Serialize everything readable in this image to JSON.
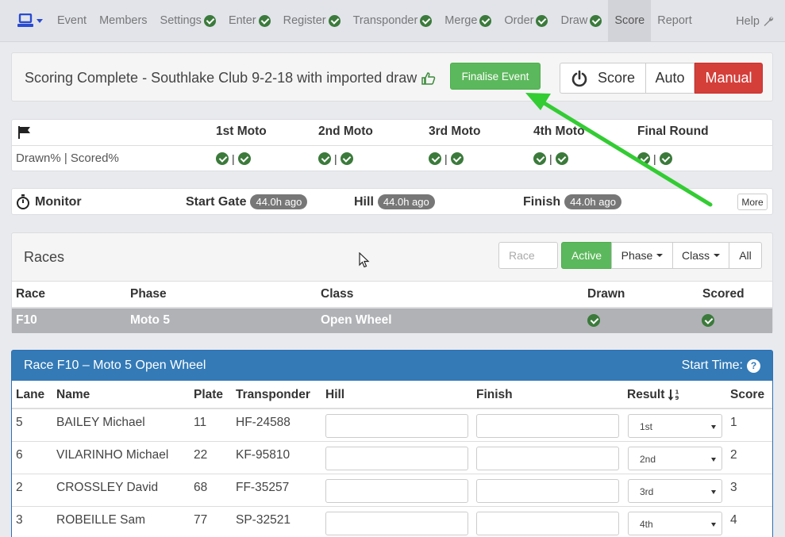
{
  "nav": {
    "items": [
      {
        "label": "Event",
        "check": false
      },
      {
        "label": "Members",
        "check": false
      },
      {
        "label": "Settings",
        "check": true
      },
      {
        "label": "Enter",
        "check": true
      },
      {
        "label": "Register",
        "check": true
      },
      {
        "label": "Transponder",
        "check": true
      },
      {
        "label": "Merge",
        "check": true
      },
      {
        "label": "Order",
        "check": true
      },
      {
        "label": "Draw",
        "check": true
      },
      {
        "label": "Score",
        "check": false
      },
      {
        "label": "Report",
        "check": false
      }
    ],
    "active": "Score",
    "help_label": "Help"
  },
  "status": {
    "title": "Scoring Complete - Southlake Club 9-2-18 with imported draw",
    "finalise_label": "Finalise Event",
    "score_label": "Score",
    "auto_label": "Auto",
    "manual_label": "Manual"
  },
  "motos": {
    "columns": [
      "1st Moto",
      "2nd Moto",
      "3rd Moto",
      "4th Moto",
      "Final Round"
    ],
    "row_label": "Drawn% | Scored%",
    "separator": "|"
  },
  "monitor": {
    "title": "Monitor",
    "start_gate_label": "Start Gate",
    "start_gate_time": "44.0h ago",
    "hill_label": "Hill",
    "hill_time": "44.0h ago",
    "finish_label": "Finish",
    "finish_time": "44.0h ago",
    "more_label": "More"
  },
  "races": {
    "title": "Races",
    "race_placeholder": "Race",
    "active_label": "Active",
    "phase_label": "Phase",
    "class_label": "Class",
    "all_label": "All",
    "headers": {
      "race": "Race",
      "phase": "Phase",
      "class": "Class",
      "drawn": "Drawn",
      "scored": "Scored"
    },
    "row": {
      "race": "F10",
      "phase": "Moto 5",
      "class": "Open Wheel"
    }
  },
  "race_detail": {
    "title": "Race F10 – Moto 5 Open Wheel",
    "start_time_label": "Start Time:",
    "headers": {
      "lane": "Lane",
      "name": "Name",
      "plate": "Plate",
      "transponder": "Transponder",
      "hill": "Hill",
      "finish": "Finish",
      "result": "Result",
      "score": "Score"
    },
    "riders": [
      {
        "lane": "5",
        "name": "BAILEY Michael",
        "plate": "11",
        "transponder": "HF-24588",
        "result": "1st",
        "score": "1"
      },
      {
        "lane": "6",
        "name": "VILARINHO Michael",
        "plate": "22",
        "transponder": "KF-95810",
        "result": "2nd",
        "score": "2"
      },
      {
        "lane": "2",
        "name": "CROSSLEY David",
        "plate": "68",
        "transponder": "FF-35257",
        "result": "3rd",
        "score": "3"
      },
      {
        "lane": "3",
        "name": "ROBEILLE Sam",
        "plate": "77",
        "transponder": "SP-32521",
        "result": "4th",
        "score": "4"
      }
    ]
  },
  "colors": {
    "primary": "#337ab7",
    "success": "#5cb85c",
    "danger": "#d43f3a",
    "check": "#3b7a3b",
    "annotation_arrow": "#33cc33"
  }
}
